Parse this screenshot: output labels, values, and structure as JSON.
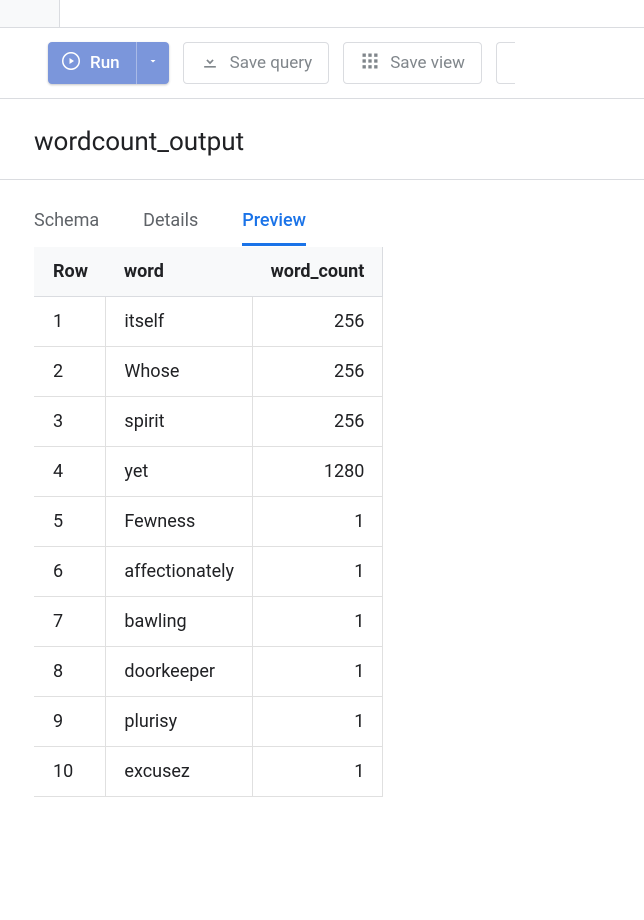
{
  "toolbar": {
    "run_label": "Run",
    "save_query_label": "Save query",
    "save_view_label": "Save view"
  },
  "page_title": "wordcount_output",
  "tabs": [
    {
      "label": "Schema",
      "active": false
    },
    {
      "label": "Details",
      "active": false
    },
    {
      "label": "Preview",
      "active": true
    }
  ],
  "table": {
    "headers": {
      "row": "Row",
      "word": "word",
      "word_count": "word_count"
    },
    "rows": [
      {
        "row": "1",
        "word": "itself",
        "word_count": "256"
      },
      {
        "row": "2",
        "word": "Whose",
        "word_count": "256"
      },
      {
        "row": "3",
        "word": "spirit",
        "word_count": "256"
      },
      {
        "row": "4",
        "word": "yet",
        "word_count": "1280"
      },
      {
        "row": "5",
        "word": "Fewness",
        "word_count": "1"
      },
      {
        "row": "6",
        "word": "affectionately",
        "word_count": "1"
      },
      {
        "row": "7",
        "word": "bawling",
        "word_count": "1"
      },
      {
        "row": "8",
        "word": "doorkeeper",
        "word_count": "1"
      },
      {
        "row": "9",
        "word": "plurisy",
        "word_count": "1"
      },
      {
        "row": "10",
        "word": "excusez",
        "word_count": "1"
      }
    ]
  }
}
